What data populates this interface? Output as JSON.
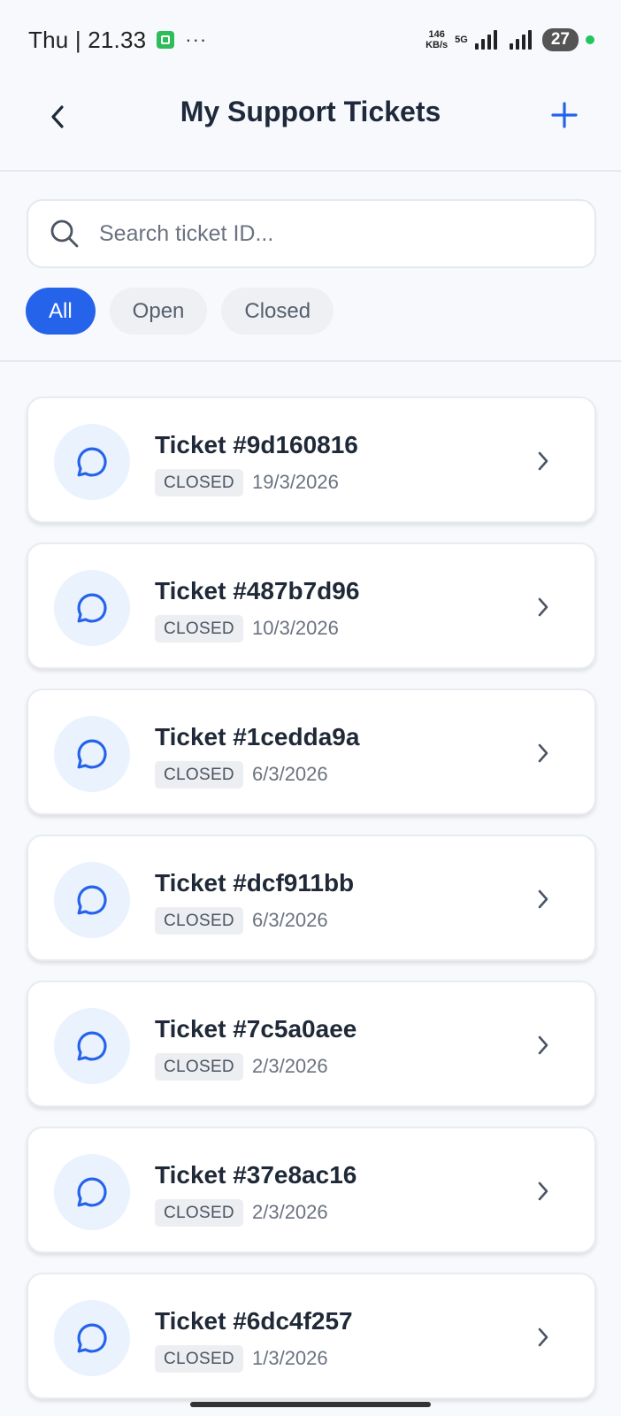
{
  "status_bar": {
    "time": "Thu | 21.33",
    "dots": "···",
    "speed_value": "146",
    "speed_unit": "KB/s",
    "network": "5G",
    "battery": "27"
  },
  "header": {
    "title": "My Support Tickets"
  },
  "search": {
    "placeholder": "Search ticket ID..."
  },
  "filters": [
    {
      "label": "All",
      "active": true
    },
    {
      "label": "Open",
      "active": false
    },
    {
      "label": "Closed",
      "active": false
    }
  ],
  "tickets": [
    {
      "title": "Ticket #9d160816",
      "status": "CLOSED",
      "date": "19/3/2026"
    },
    {
      "title": "Ticket #487b7d96",
      "status": "CLOSED",
      "date": "10/3/2026"
    },
    {
      "title": "Ticket #1cedda9a",
      "status": "CLOSED",
      "date": "6/3/2026"
    },
    {
      "title": "Ticket #dcf911bb",
      "status": "CLOSED",
      "date": "6/3/2026"
    },
    {
      "title": "Ticket #7c5a0aee",
      "status": "CLOSED",
      "date": "2/3/2026"
    },
    {
      "title": "Ticket #37e8ac16",
      "status": "CLOSED",
      "date": "2/3/2026"
    },
    {
      "title": "Ticket #6dc4f257",
      "status": "CLOSED",
      "date": "1/3/2026"
    }
  ],
  "colors": {
    "accent": "#2563eb",
    "icon_bg": "#eaf2fe",
    "badge_bg": "#eceef1",
    "background": "#f7f9fc"
  },
  "icons": {
    "back": "chevron-left-icon",
    "add": "plus-icon",
    "search": "search-icon",
    "ticket": "chat-bubble-icon",
    "row_arrow": "chevron-right-icon"
  }
}
